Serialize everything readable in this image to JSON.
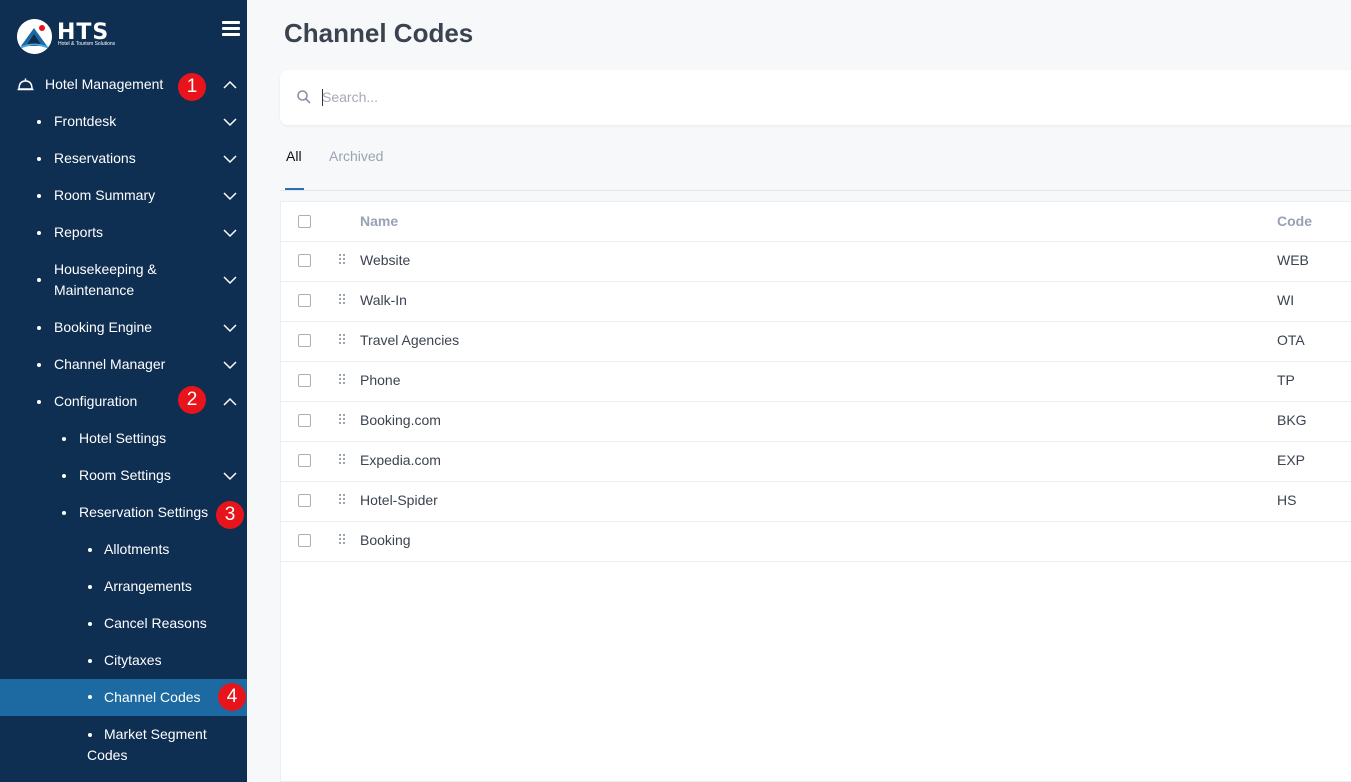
{
  "app": {
    "logo_text": "HTS",
    "logo_subtitle": "Hotel & Tourism Solutions"
  },
  "sidebar": {
    "hotel_management": "Hotel Management",
    "items": [
      {
        "label": "Frontdesk"
      },
      {
        "label": "Reservations"
      },
      {
        "label": "Room Summary"
      },
      {
        "label": "Reports"
      },
      {
        "label": "Housekeeping &",
        "label2": "Maintenance"
      },
      {
        "label": "Booking Engine"
      },
      {
        "label": "Channel Manager"
      },
      {
        "label": "Configuration"
      }
    ],
    "config_items": [
      {
        "label": "Hotel Settings"
      },
      {
        "label": "Room Settings"
      },
      {
        "label": "Reservation Settings"
      }
    ],
    "reservation_items": [
      {
        "label": "Allotments"
      },
      {
        "label": "Arrangements"
      },
      {
        "label": "Cancel Reasons"
      },
      {
        "label": "Citytaxes"
      },
      {
        "label": "Channel Codes"
      },
      {
        "label": "Market Segment",
        "label2": "Codes"
      }
    ],
    "badges": [
      "1",
      "2",
      "3",
      "4"
    ]
  },
  "main": {
    "title": "Channel Codes",
    "search_placeholder": "Search...",
    "tabs": [
      {
        "label": "All"
      },
      {
        "label": "Archived"
      }
    ],
    "table": {
      "columns": [
        "Name",
        "Code"
      ],
      "rows": [
        {
          "name": "Website",
          "code": "WEB"
        },
        {
          "name": "Walk-In",
          "code": "WI"
        },
        {
          "name": "Travel Agencies",
          "code": "OTA"
        },
        {
          "name": "Phone",
          "code": "TP"
        },
        {
          "name": "Booking.com",
          "code": "BKG"
        },
        {
          "name": "Expedia.com",
          "code": "EXP"
        },
        {
          "name": "Hotel-Spider",
          "code": "HS"
        },
        {
          "name": "Booking",
          "code": ""
        }
      ]
    }
  },
  "colors": {
    "sidebar_bg": "#0e2e52",
    "active_item": "#1c6aa1",
    "badge": "#e8141b"
  }
}
